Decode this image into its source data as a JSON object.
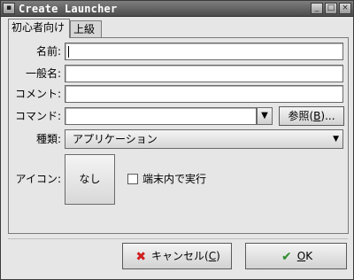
{
  "window": {
    "title": "Create Launcher"
  },
  "tabs": [
    {
      "label": "初心者向け",
      "active": true
    },
    {
      "label": "上級",
      "active": false
    }
  ],
  "form": {
    "name_label": "名前:",
    "name_value": "",
    "generic_name_label": "一般名:",
    "generic_name_value": "",
    "comment_label": "コメント:",
    "comment_value": "",
    "command_label": "コマンド:",
    "command_value": "",
    "browse_label_pre": "参照(",
    "browse_mnemonic": "B",
    "browse_label_post": ")...",
    "type_label": "種類:",
    "type_value": "アプリケーション",
    "icon_label": "アイコン:",
    "icon_button_label": "なし",
    "terminal_label": "端末内で実行",
    "terminal_checked": false
  },
  "buttons": {
    "cancel_pre": "キャンセル(",
    "cancel_mnemonic": "C",
    "cancel_post": ")",
    "ok_mnemonic": "O",
    "ok_post": "K"
  }
}
